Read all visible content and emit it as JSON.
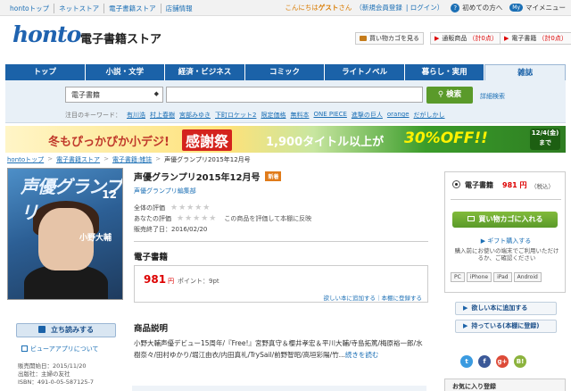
{
  "topbar": {
    "nav": [
      "hontoトップ",
      "ネットストア",
      "電子書籍ストア",
      "店舗情報"
    ],
    "greeting_prefix": "こんにちは",
    "greeting_name": "ゲスト",
    "greeting_suffix": "さん",
    "register": "（新規会員登録",
    "login": "| ログイン）",
    "first_time": "初めての方へ",
    "my_badge": "My",
    "mypage": "マイメニュー"
  },
  "header": {
    "logo": "honto",
    "store_name": "電子書籍ストア",
    "cart": {
      "label": "買い物カゴを見る",
      "count": ""
    },
    "overdue": {
      "label": "通販商品",
      "count": "（計0点）"
    },
    "ebook": {
      "label": "電子書籍",
      "count": "（計0点）"
    }
  },
  "tabs": [
    "トップ",
    "小説・文学",
    "経済・ビジネス",
    "コミック",
    "ライトノベル",
    "暮らし・実用",
    "雑誌"
  ],
  "search": {
    "select_value": "電子書籍",
    "button": "検索",
    "advanced": "詳細検索",
    "keywords_label": "注目のキーワード：",
    "keywords": [
      "有川浩",
      "村上春樹",
      "宮部みゆき",
      "下町ロケット2",
      "限定価格",
      "無料本",
      "ONE PIECE",
      "進撃の巨人",
      "orange",
      "だがしかし"
    ]
  },
  "banner": {
    "text1": "冬もぴっかぴか小デジ!",
    "text2": "感謝祭",
    "text3": "1,900タイトル以上が",
    "text4": "30%OFF!!",
    "date_line1": "12/4(金)",
    "date_line2": "まで"
  },
  "breadcrumb": [
    "hontoトップ",
    "電子書籍ストア",
    "電子書籍:雑誌",
    "声優グランプリ2015年12月号"
  ],
  "cover": {
    "masthead": "声優グランプリ",
    "issue": "12",
    "name": "小野大輔"
  },
  "product": {
    "title": "声優グランプリ2015年12月号",
    "badge": "新着",
    "author": "声優グランプリ編集部",
    "rating_overall_label": "全体の評価",
    "rating_mine_label": "あなたの評価",
    "rating_note": "この商品を評価して本棚に反映",
    "stars": "★★★★★",
    "end_date": "販売終了日：2016/02/20",
    "section_format": "電子書籍",
    "price": "981",
    "price_unit": "円",
    "points": "ポイント：9pt",
    "wishlist_links": "欲しい本に追加する｜本棚に登録する",
    "section_desc": "商品説明",
    "description": "小野大輔声優デビュー15周年/『Free!』宮野真守＆櫻井孝宏＆平川大輔/寺島拓篤/梅原裕一郎/水樹奈々/田村ゆかり/堀江由衣/内田真礼/TrySail/前野智昭/高垣彩陽/竹...",
    "more": "続きを読む"
  },
  "left": {
    "read_button": "立ち読みする",
    "viewer": "ビューアアプリについて",
    "pub_date": "販売開始日：2015/11/20",
    "publisher": "出版社：主婦の友社",
    "isbn": "ISBN：491-0-05-587125-7"
  },
  "purchase": {
    "format": "電子書籍",
    "price": "981 円",
    "tax": "（税込）",
    "cart_button": "買い物カゴに入れる",
    "gift": "ギフト購入する",
    "note": "購入前にお使いの端末でご利用いただけるか、ご確認ください",
    "devices": [
      "PC",
      "iPhone",
      "iPad",
      "Android"
    ],
    "wish_button": "欲しい本に追加する",
    "own_button": "持っている(本棚に登録)",
    "favorites": "お気に入り登録"
  },
  "colors": {
    "brand": "#1b62a8",
    "price": "#dd0000",
    "cart": "#5a9a2a"
  }
}
